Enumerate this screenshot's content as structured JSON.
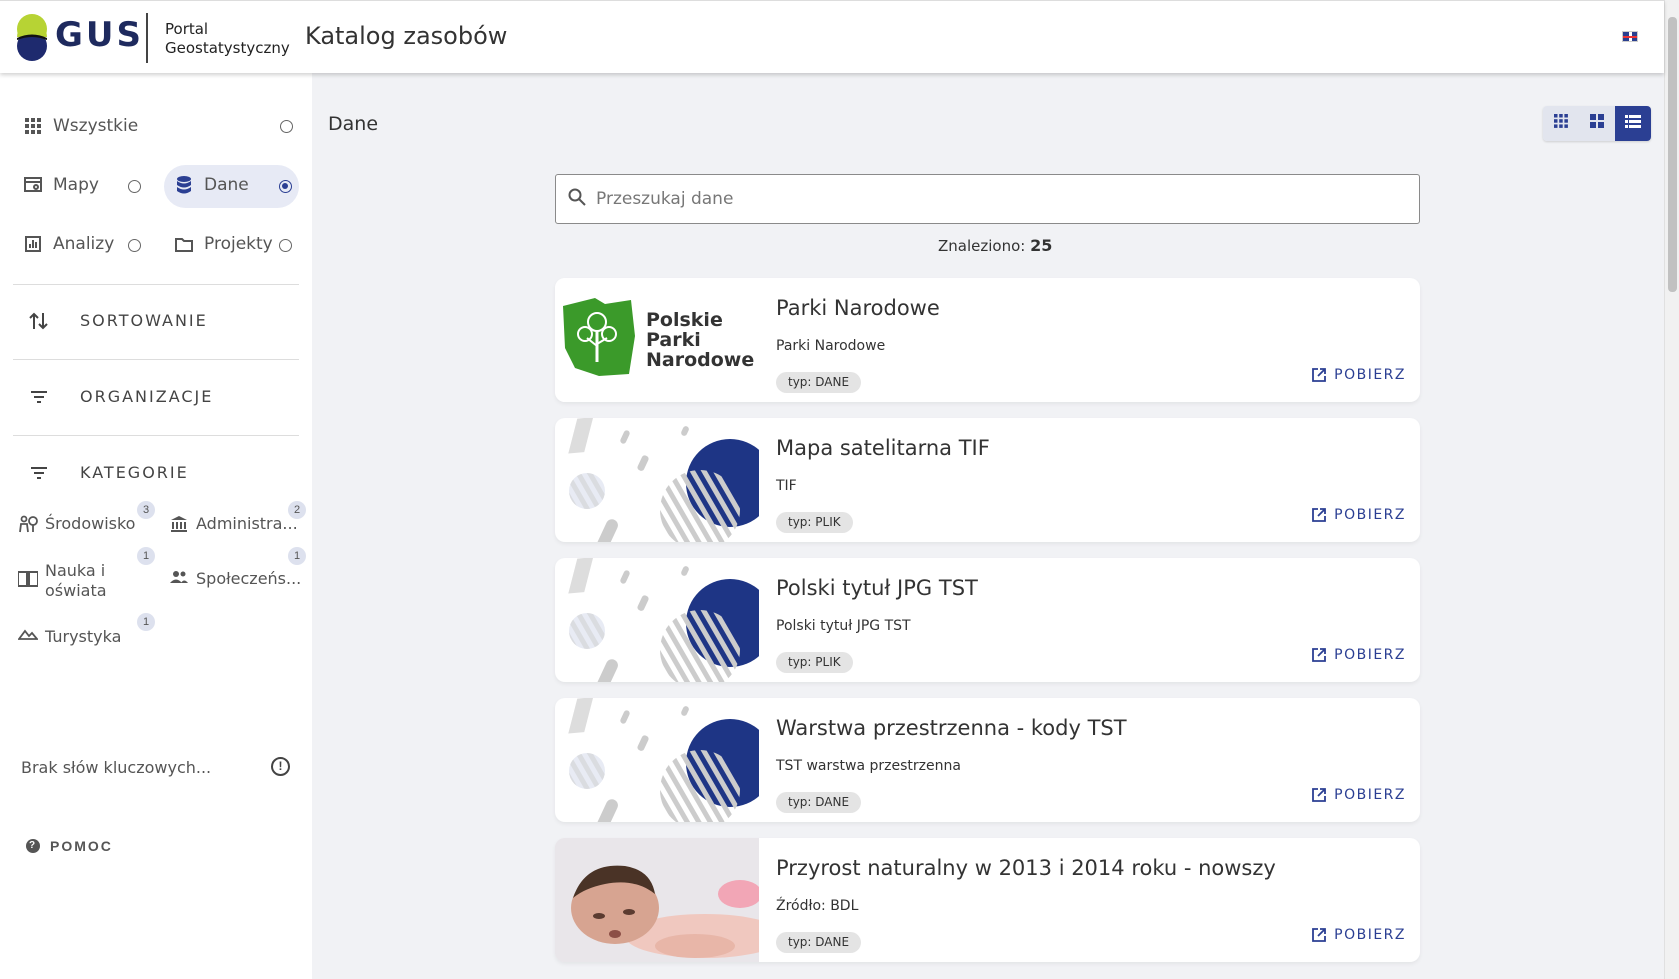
{
  "header": {
    "logo_text": "GUS",
    "portal_line1": "Portal",
    "portal_line2": "Geostatystyczny",
    "title": "Katalog zasobów",
    "language_flag": "en-flag-icon"
  },
  "sidebar": {
    "types": [
      {
        "label": "Wszystkie",
        "icon": "apps-grid-icon",
        "selected": false
      },
      {
        "label": "Mapy",
        "icon": "map-icon",
        "selected": false
      },
      {
        "label": "Dane",
        "icon": "database-icon",
        "selected": true
      },
      {
        "label": "Analizy",
        "icon": "chart-icon",
        "selected": false
      },
      {
        "label": "Projekty",
        "icon": "folder-icon",
        "selected": false
      }
    ],
    "sections": {
      "sort": "SORTOWANIE",
      "organizations": "ORGANIZACJE",
      "categories": "KATEGORIE"
    },
    "categories": [
      {
        "label": "Środowisko",
        "count": "3",
        "icon": "nature-people-icon"
      },
      {
        "label": "Administra...",
        "count": "2",
        "icon": "institution-icon"
      },
      {
        "label_line1": "Nauka i",
        "label_line2": "oświata",
        "count": "1",
        "icon": "book-icon"
      },
      {
        "label": "Społeczeńs...",
        "count": "1",
        "icon": "people-icon"
      },
      {
        "label": "Turystyka",
        "count": "1",
        "icon": "landscape-icon"
      }
    ],
    "keywords_placeholder": "Brak słów kluczowych...",
    "help": "POMOC"
  },
  "main": {
    "title": "Dane",
    "search_placeholder": "Przeszukaj dane",
    "found_label": "Znaleziono:",
    "found_count": "25",
    "download_label": "POBIERZ",
    "thumb_logo": {
      "line1": "Polskie",
      "line2": "Parki",
      "line3": "Narodowe"
    },
    "cards": [
      {
        "title": "Parki Narodowe",
        "subtitle": "Parki Narodowe",
        "tag": "typ: DANE",
        "thumb": "parks-logo"
      },
      {
        "title": "Mapa satelitarna TIF",
        "subtitle": "TIF",
        "tag": "typ: PLIK",
        "thumb": "placeholder"
      },
      {
        "title": "Polski tytuł JPG TST",
        "subtitle": "Polski tytuł JPG TST",
        "tag": "typ: PLIK",
        "thumb": "placeholder"
      },
      {
        "title": "Warstwa przestrzenna - kody TST",
        "subtitle": "TST warstwa przestrzenna",
        "tag": "typ: DANE",
        "thumb": "placeholder"
      },
      {
        "title": "Przyrost naturalny w 2013 i 2014 roku - nowszy",
        "subtitle": "Źródło: BDL",
        "tag": "typ: DANE",
        "thumb": "baby-photo"
      }
    ]
  },
  "colors": {
    "accent": "#2b3f93",
    "background": "#f1f2f5",
    "logo_green": "#3b9a2a"
  }
}
